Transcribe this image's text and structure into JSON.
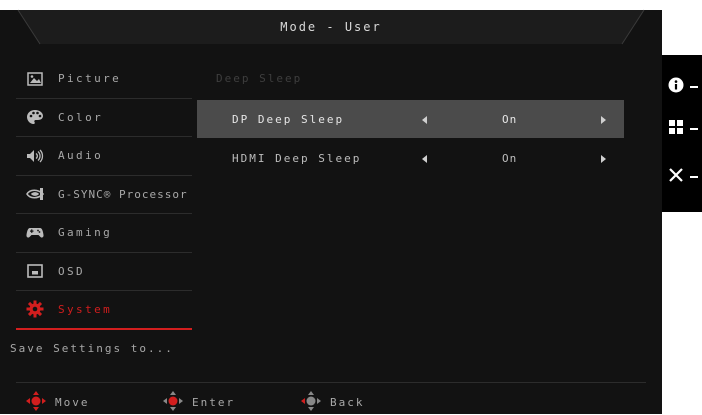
{
  "title": "Mode - User",
  "sidebar": {
    "items": [
      {
        "label": "Picture",
        "icon": "picture-icon"
      },
      {
        "label": "Color",
        "icon": "palette-icon"
      },
      {
        "label": "Audio",
        "icon": "speaker-icon"
      },
      {
        "label": "G-SYNC® Processor",
        "icon": "nvidia-icon"
      },
      {
        "label": "Gaming",
        "icon": "gamepad-icon"
      },
      {
        "label": "OSD",
        "icon": "osd-icon"
      },
      {
        "label": "System",
        "icon": "gear-icon",
        "active": true
      },
      {
        "label": "Save Settings to...",
        "icon": ""
      }
    ]
  },
  "main": {
    "section_label": "Deep Sleep",
    "options": [
      {
        "label": "DP Deep Sleep",
        "value": "On",
        "selected": true
      },
      {
        "label": "HDMI Deep Sleep",
        "value": "On",
        "selected": false
      }
    ]
  },
  "footer": {
    "move": "Move",
    "enter": "Enter",
    "back": "Back"
  },
  "hotkeys": [
    "info-icon",
    "menu-icon",
    "close-icon"
  ],
  "colors": {
    "accent": "#d21e1e",
    "background": "#121212",
    "selected_row": "#4b4b4b"
  }
}
